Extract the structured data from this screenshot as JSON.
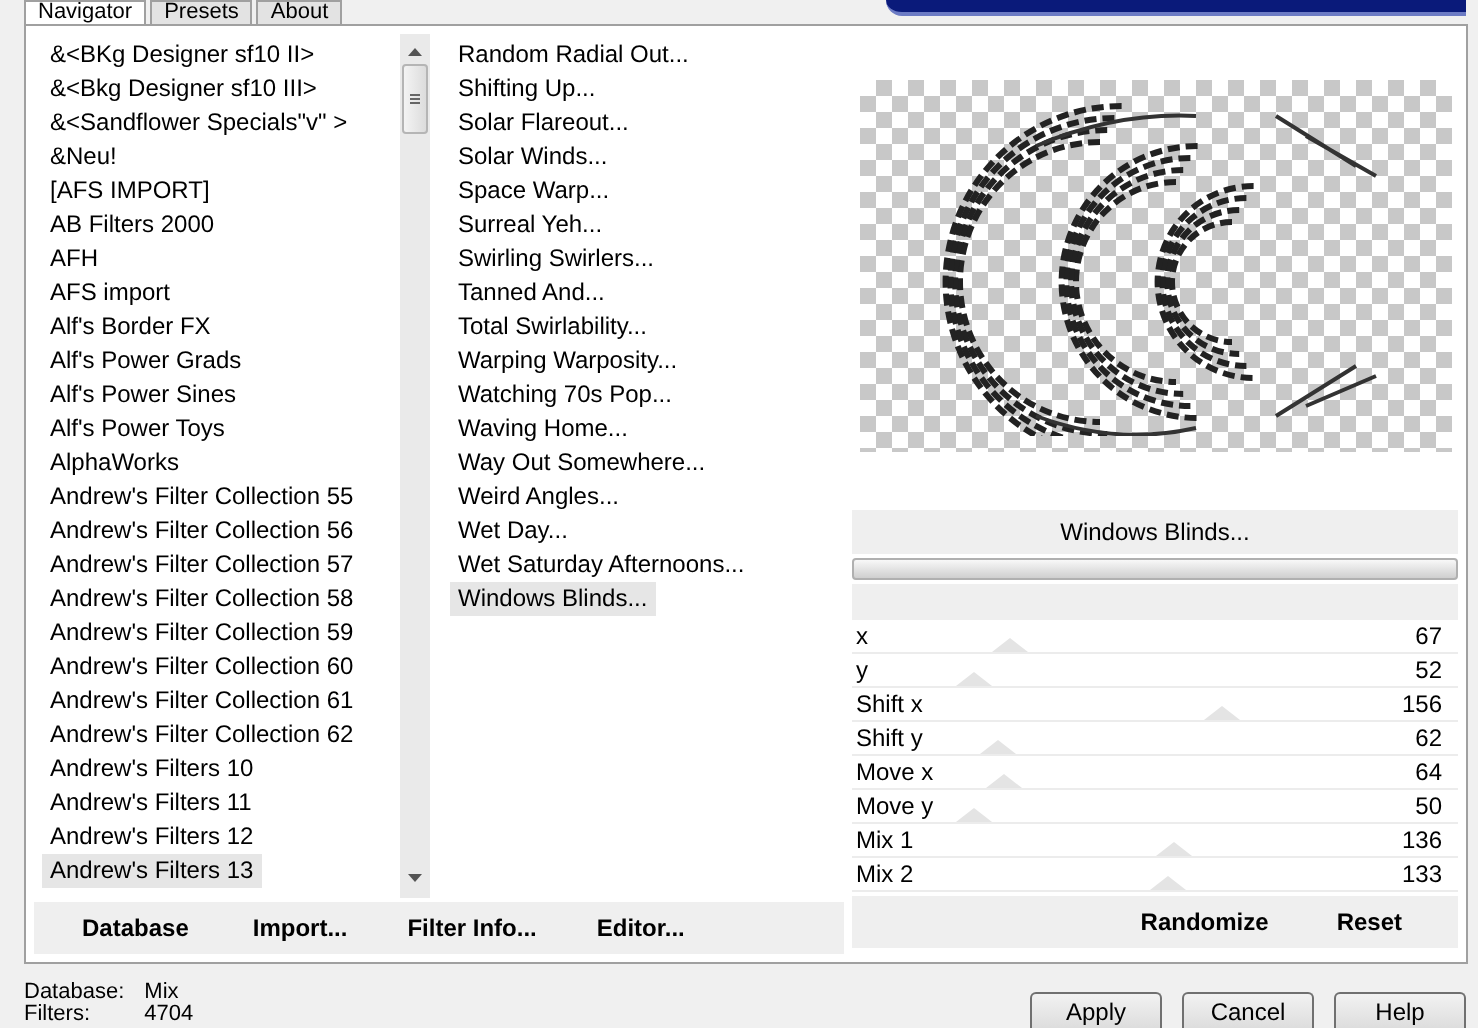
{
  "tabs": [
    {
      "label": "Navigator",
      "selected": true
    },
    {
      "label": "Presets",
      "selected": false
    },
    {
      "label": "About",
      "selected": false
    }
  ],
  "categories": [
    {
      "label": "&<BKg Designer sf10 II>",
      "selected": false
    },
    {
      "label": "&<Bkg Designer sf10 III>",
      "selected": false
    },
    {
      "label": "&<Sandflower Specials\"v\" >",
      "selected": false
    },
    {
      "label": "&Neu!",
      "selected": false
    },
    {
      "label": "[AFS IMPORT]",
      "selected": false
    },
    {
      "label": "AB Filters 2000",
      "selected": false
    },
    {
      "label": "AFH",
      "selected": false
    },
    {
      "label": "AFS import",
      "selected": false
    },
    {
      "label": "Alf's Border FX",
      "selected": false
    },
    {
      "label": "Alf's Power Grads",
      "selected": false
    },
    {
      "label": "Alf's Power Sines",
      "selected": false
    },
    {
      "label": "Alf's Power Toys",
      "selected": false
    },
    {
      "label": "AlphaWorks",
      "selected": false
    },
    {
      "label": "Andrew's Filter Collection 55",
      "selected": false
    },
    {
      "label": "Andrew's Filter Collection 56",
      "selected": false
    },
    {
      "label": "Andrew's Filter Collection 57",
      "selected": false
    },
    {
      "label": "Andrew's Filter Collection 58",
      "selected": false
    },
    {
      "label": "Andrew's Filter Collection 59",
      "selected": false
    },
    {
      "label": "Andrew's Filter Collection 60",
      "selected": false
    },
    {
      "label": "Andrew's Filter Collection 61",
      "selected": false
    },
    {
      "label": "Andrew's Filter Collection 62",
      "selected": false
    },
    {
      "label": "Andrew's Filters 10",
      "selected": false
    },
    {
      "label": "Andrew's Filters 11",
      "selected": false
    },
    {
      "label": "Andrew's Filters 12",
      "selected": false
    },
    {
      "label": "Andrew's Filters 13",
      "selected": true
    }
  ],
  "filters": [
    {
      "label": "Random Radial Out...",
      "selected": false
    },
    {
      "label": "Shifting Up...",
      "selected": false
    },
    {
      "label": "Solar Flareout...",
      "selected": false
    },
    {
      "label": "Solar Winds...",
      "selected": false
    },
    {
      "label": "Space Warp...",
      "selected": false
    },
    {
      "label": "Surreal Yeh...",
      "selected": false
    },
    {
      "label": "Swirling Swirlers...",
      "selected": false
    },
    {
      "label": "Tanned And...",
      "selected": false
    },
    {
      "label": "Total Swirlability...",
      "selected": false
    },
    {
      "label": "Warping Warposity...",
      "selected": false
    },
    {
      "label": "Watching 70s Pop...",
      "selected": false
    },
    {
      "label": "Waving Home...",
      "selected": false
    },
    {
      "label": "Way Out Somewhere...",
      "selected": false
    },
    {
      "label": "Weird Angles...",
      "selected": false
    },
    {
      "label": "Wet Day...",
      "selected": false
    },
    {
      "label": "Wet Saturday Afternoons...",
      "selected": false
    },
    {
      "label": "Windows Blinds...",
      "selected": true
    }
  ],
  "list_buttons": [
    "Database",
    "Import...",
    "Filter Info...",
    "Editor..."
  ],
  "preview": {
    "filter_name": "Windows Blinds..."
  },
  "sliders": [
    {
      "label": "x",
      "value": "67",
      "level": 0.26
    },
    {
      "label": "y",
      "value": "52",
      "level": 0.2
    },
    {
      "label": "Shift x",
      "value": "156",
      "level": 0.61
    },
    {
      "label": "Shift y",
      "value": "62",
      "level": 0.24
    },
    {
      "label": "Move x",
      "value": "64",
      "level": 0.25
    },
    {
      "label": "Move y",
      "value": "50",
      "level": 0.2
    },
    {
      "label": "Mix 1",
      "value": "136",
      "level": 0.53
    },
    {
      "label": "Mix 2",
      "value": "133",
      "level": 0.52
    }
  ],
  "slider_buttons": [
    "Randomize",
    "Reset"
  ],
  "status": [
    {
      "label": "Database:",
      "value": "Mix"
    },
    {
      "label": "Filters:",
      "value": "4704"
    }
  ],
  "dialog_buttons": [
    "Apply",
    "Cancel",
    "Help"
  ]
}
